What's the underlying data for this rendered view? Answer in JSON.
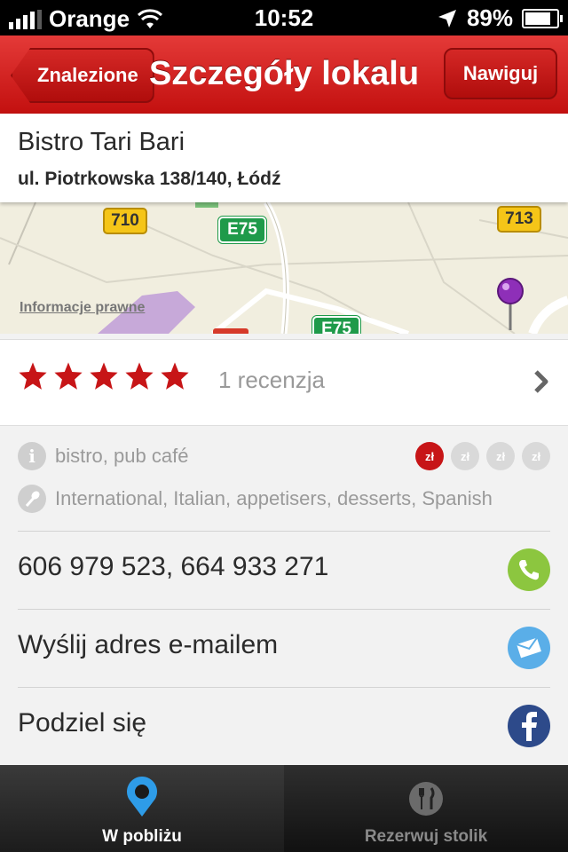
{
  "status": {
    "carrier": "Orange",
    "time": "10:52",
    "battery": "89%"
  },
  "nav": {
    "back_label": "Znalezione",
    "title": "Szczegóły lokalu",
    "navigate_label": "Nawiguj"
  },
  "place": {
    "name": "Bistro Tari Bari",
    "address": "ul. Piotrkowska 138/140, Łódź"
  },
  "map": {
    "legal_link": "Informacje prawne",
    "road_labels": {
      "r710": "710",
      "r713": "713",
      "e75a": "E75",
      "e75b": "E75"
    }
  },
  "reviews": {
    "rating": 5,
    "max_rating": 5,
    "count_label": "1 recenzja"
  },
  "info": {
    "type": "bistro, pub café",
    "cuisine": "International, Italian, appetisers, desserts, Spanish",
    "price_symbol": "zł",
    "price_level": 1,
    "price_max": 4
  },
  "actions": {
    "phone": "606 979 523, 664 933 271",
    "email": "Wyślij adres e-mailem",
    "share": "Podziel się"
  },
  "tabs": [
    {
      "label": "W pobliżu",
      "active": true
    },
    {
      "label": "Rezerwuj stolik",
      "active": false
    }
  ],
  "colors": {
    "brand_red": "#c71517",
    "phone_green": "#8cc63f",
    "mail_blue": "#5aaee8",
    "facebook_blue": "#2d4a8a"
  }
}
